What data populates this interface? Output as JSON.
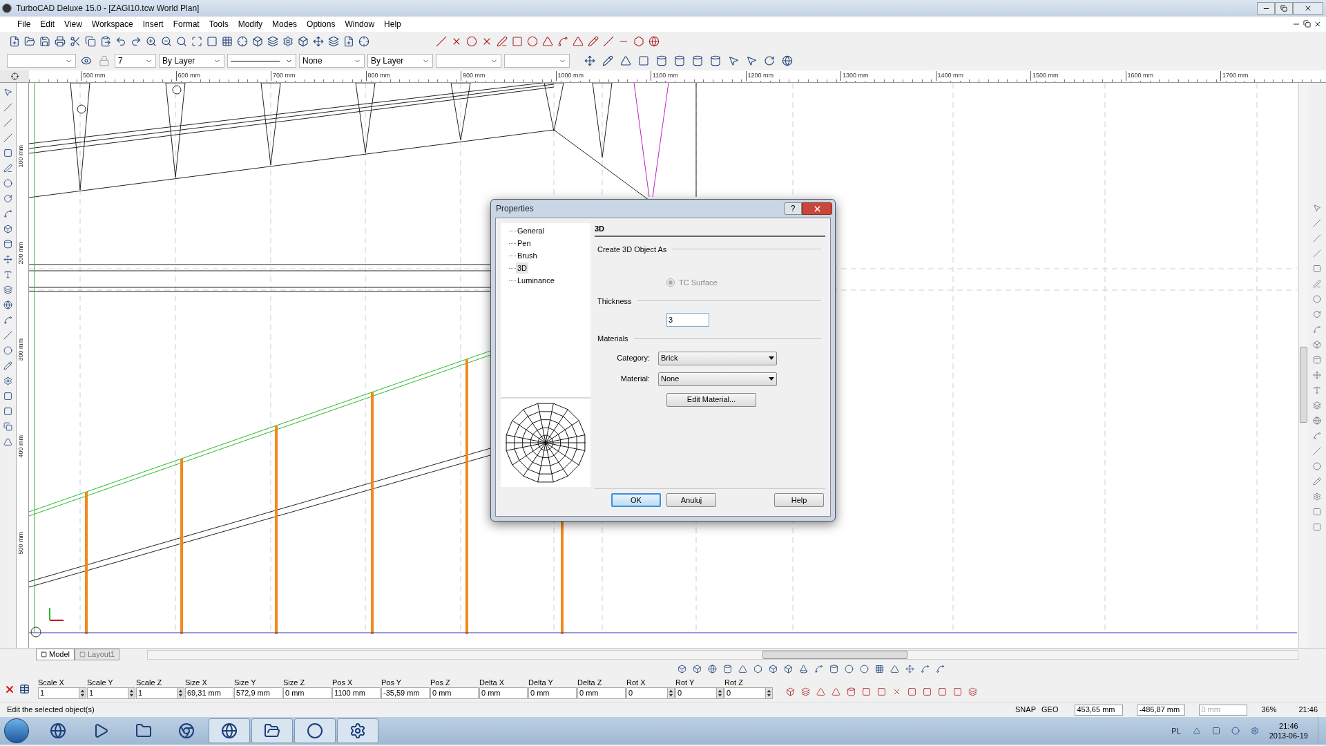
{
  "window": {
    "title": "TurboCAD Deluxe 15.0 - [ZAGI10.tcw World Plan]"
  },
  "menu": [
    "File",
    "Edit",
    "View",
    "Workspace",
    "Insert",
    "Format",
    "Tools",
    "Modify",
    "Modes",
    "Options",
    "Window",
    "Help"
  ],
  "property_toolbar": {
    "layer": "7",
    "ink_source": "By Layer",
    "pen": "None",
    "width_source": "By Layer"
  },
  "ruler": {
    "x_labels": [
      "500 mm",
      "600 mm",
      "700 mm",
      "800 mm",
      "900 mm",
      "1000 mm",
      "1100 mm",
      "1200 mm",
      "1300 mm",
      "1400 mm",
      "1500 mm",
      "1600 mm",
      "1700 mm"
    ],
    "y_labels": [
      "100 mm",
      "200 mm",
      "300 mm",
      "400 mm",
      "500 mm"
    ]
  },
  "tabs": [
    {
      "label": "Model",
      "selected": true
    },
    {
      "label": "Layout1",
      "selected": false
    }
  ],
  "inspector": {
    "fields": [
      {
        "label": "Scale X",
        "value": "1",
        "kind": "spin"
      },
      {
        "label": "Scale Y",
        "value": "1",
        "kind": "spin"
      },
      {
        "label": "Scale Z",
        "value": "1",
        "kind": "spin"
      },
      {
        "label": "Size X",
        "value": "69,31 mm",
        "kind": "text"
      },
      {
        "label": "Size Y",
        "value": "572,9 mm",
        "kind": "text"
      },
      {
        "label": "Size Z",
        "value": "0 mm",
        "kind": "text"
      },
      {
        "label": "Pos X",
        "value": "1100 mm",
        "kind": "text"
      },
      {
        "label": "Pos Y",
        "value": "-35,59 mm",
        "kind": "text"
      },
      {
        "label": "Pos Z",
        "value": "0 mm",
        "kind": "text"
      },
      {
        "label": "Delta X",
        "value": "0 mm",
        "kind": "text"
      },
      {
        "label": "Delta Y",
        "value": "0 mm",
        "kind": "text"
      },
      {
        "label": "Delta Z",
        "value": "0 mm",
        "kind": "text"
      },
      {
        "label": "Rot X",
        "value": "0",
        "kind": "spin"
      },
      {
        "label": "Rot Y",
        "value": "0",
        "kind": "spin"
      },
      {
        "label": "Rot Z",
        "value": "0",
        "kind": "spin"
      }
    ]
  },
  "status_bar": {
    "message": "Edit the selected object(s)",
    "snap": "SNAP",
    "geo": "GEO",
    "x": "453,65 mm",
    "y": "-486,87 mm",
    "z_placeholder": "0 mm",
    "zoom": "36%",
    "time": "21:46"
  },
  "taskbar": {
    "language": "PL",
    "time": "21:46",
    "date": "2013-06-19"
  },
  "dialog": {
    "title": "Properties",
    "help_glyph": "?",
    "tree": [
      {
        "label": "General",
        "selected": false
      },
      {
        "label": "Pen",
        "selected": false
      },
      {
        "label": "Brush",
        "selected": false
      },
      {
        "label": "3D",
        "selected": true
      },
      {
        "label": "Luminance",
        "selected": false
      }
    ],
    "heading": "3D",
    "create_group": "Create 3D Object As",
    "radio": {
      "label": "TC Surface",
      "checked": true,
      "disabled": true
    },
    "thickness_group": "Thickness",
    "thickness": "3",
    "materials_group": "Materials",
    "category": {
      "label": "Category:",
      "value": "Brick"
    },
    "material": {
      "label": "Material:",
      "value": "None"
    },
    "edit_button": "Edit Material...",
    "buttons": [
      {
        "label": "OK",
        "default": true
      },
      {
        "label": "Anuluj",
        "default": false
      },
      {
        "label": "Help",
        "default": false
      }
    ]
  }
}
